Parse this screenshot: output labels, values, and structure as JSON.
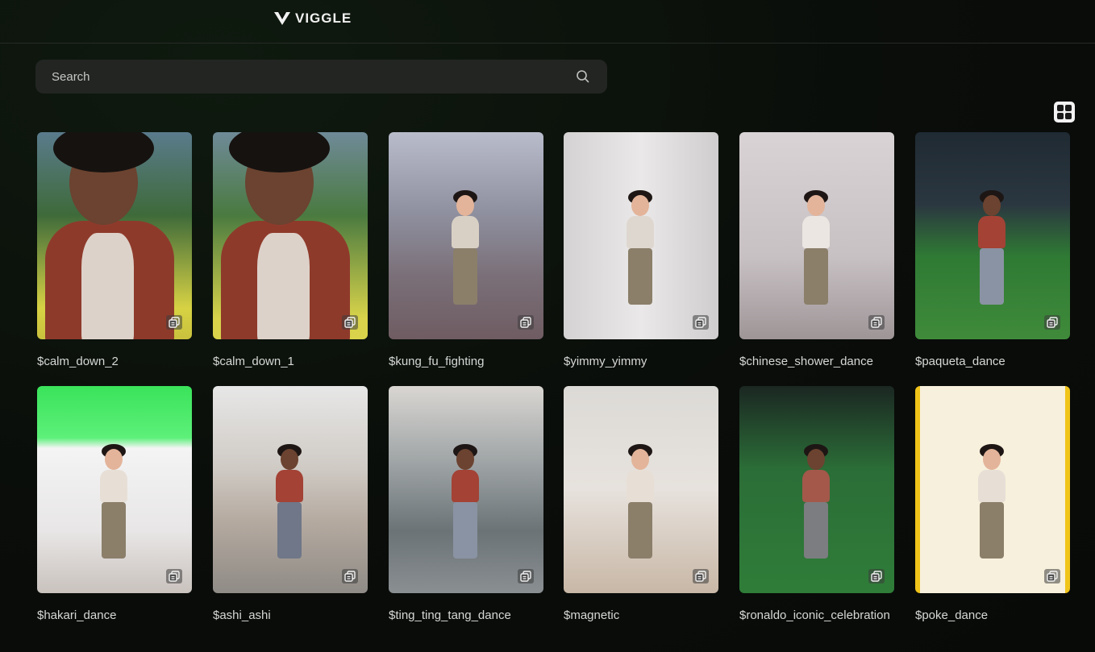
{
  "header": {
    "logo_text": "VIGGLE"
  },
  "search": {
    "placeholder": "Search",
    "value": ""
  },
  "cards": [
    {
      "label": "$calm_down_2"
    },
    {
      "label": "$calm_down_1"
    },
    {
      "label": "$kung_fu_fighting"
    },
    {
      "label": "$yimmy_yimmy"
    },
    {
      "label": "$chinese_shower_dance"
    },
    {
      "label": "$paqueta_dance"
    },
    {
      "label": "$hakari_dance"
    },
    {
      "label": "$ashi_ashi"
    },
    {
      "label": "$ting_ting_tang_dance"
    },
    {
      "label": "$magnetic"
    },
    {
      "label": "$ronaldo_iconic_celebration"
    },
    {
      "label": "$poke_dance"
    }
  ],
  "colors": {
    "accent": "#f3f3f3",
    "background": "#0b0f0b"
  }
}
